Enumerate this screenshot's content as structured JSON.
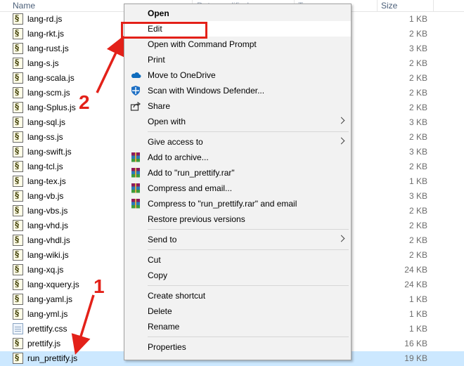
{
  "header": {
    "name": "Name",
    "date": "Date modified",
    "type": "Type",
    "size": "Size"
  },
  "files": [
    {
      "name": "lang-rd.js",
      "size": "1 KB",
      "icon": "js-file-icon"
    },
    {
      "name": "lang-rkt.js",
      "size": "2 KB",
      "icon": "js-file-icon"
    },
    {
      "name": "lang-rust.js",
      "size": "3 KB",
      "icon": "js-file-icon"
    },
    {
      "name": "lang-s.js",
      "size": "2 KB",
      "icon": "js-file-icon"
    },
    {
      "name": "lang-scala.js",
      "size": "2 KB",
      "icon": "js-file-icon"
    },
    {
      "name": "lang-scm.js",
      "size": "2 KB",
      "icon": "js-file-icon"
    },
    {
      "name": "lang-Splus.js",
      "size": "2 KB",
      "icon": "js-file-icon"
    },
    {
      "name": "lang-sql.js",
      "size": "3 KB",
      "icon": "js-file-icon"
    },
    {
      "name": "lang-ss.js",
      "size": "2 KB",
      "icon": "js-file-icon"
    },
    {
      "name": "lang-swift.js",
      "size": "3 KB",
      "icon": "js-file-icon"
    },
    {
      "name": "lang-tcl.js",
      "size": "2 KB",
      "icon": "js-file-icon"
    },
    {
      "name": "lang-tex.js",
      "size": "1 KB",
      "icon": "js-file-icon"
    },
    {
      "name": "lang-vb.js",
      "size": "3 KB",
      "icon": "js-file-icon"
    },
    {
      "name": "lang-vbs.js",
      "size": "2 KB",
      "icon": "js-file-icon"
    },
    {
      "name": "lang-vhd.js",
      "size": "2 KB",
      "icon": "js-file-icon"
    },
    {
      "name": "lang-vhdl.js",
      "size": "2 KB",
      "icon": "js-file-icon"
    },
    {
      "name": "lang-wiki.js",
      "size": "2 KB",
      "icon": "js-file-icon"
    },
    {
      "name": "lang-xq.js",
      "size": "24 KB",
      "icon": "js-file-icon"
    },
    {
      "name": "lang-xquery.js",
      "size": "24 KB",
      "icon": "js-file-icon"
    },
    {
      "name": "lang-yaml.js",
      "size": "1 KB",
      "icon": "js-file-icon"
    },
    {
      "name": "lang-yml.js",
      "size": "1 KB",
      "icon": "js-file-icon"
    },
    {
      "name": "prettify.css",
      "size": "1 KB",
      "icon": "css-file-icon"
    },
    {
      "name": "prettify.js",
      "size": "16 KB",
      "icon": "js-file-icon"
    },
    {
      "name": "run_prettify.js",
      "size": "19 KB",
      "icon": "js-file-icon",
      "selected": true
    }
  ],
  "menu": {
    "groups": [
      [
        {
          "label": "Open",
          "bold": true
        },
        {
          "label": "Edit",
          "highlighted": true
        },
        {
          "label": "Open with Command Prompt"
        },
        {
          "label": "Print"
        },
        {
          "label": "Move to OneDrive",
          "icon": "onedrive-cloud-icon"
        },
        {
          "label": "Scan with Windows Defender...",
          "icon": "windows-defender-icon"
        },
        {
          "label": "Share",
          "icon": "share-icon"
        },
        {
          "label": "Open with",
          "submenu": true
        }
      ],
      [
        {
          "label": "Give access to",
          "submenu": true
        },
        {
          "label": "Add to archive...",
          "icon": "winrar-icon"
        },
        {
          "label": "Add to \"run_prettify.rar\"",
          "icon": "winrar-icon"
        },
        {
          "label": "Compress and email...",
          "icon": "winrar-icon"
        },
        {
          "label": "Compress to \"run_prettify.rar\" and email",
          "icon": "winrar-icon"
        },
        {
          "label": "Restore previous versions"
        }
      ],
      [
        {
          "label": "Send to",
          "submenu": true
        }
      ],
      [
        {
          "label": "Cut"
        },
        {
          "label": "Copy"
        }
      ],
      [
        {
          "label": "Create shortcut"
        },
        {
          "label": "Delete"
        },
        {
          "label": "Rename"
        }
      ],
      [
        {
          "label": "Properties"
        }
      ]
    ]
  },
  "annotations": {
    "step1": "1",
    "step2": "2"
  },
  "colors": {
    "annotation_red": "#e32119",
    "selection": "#cce8ff",
    "menu_bg": "#f2f2f2"
  }
}
